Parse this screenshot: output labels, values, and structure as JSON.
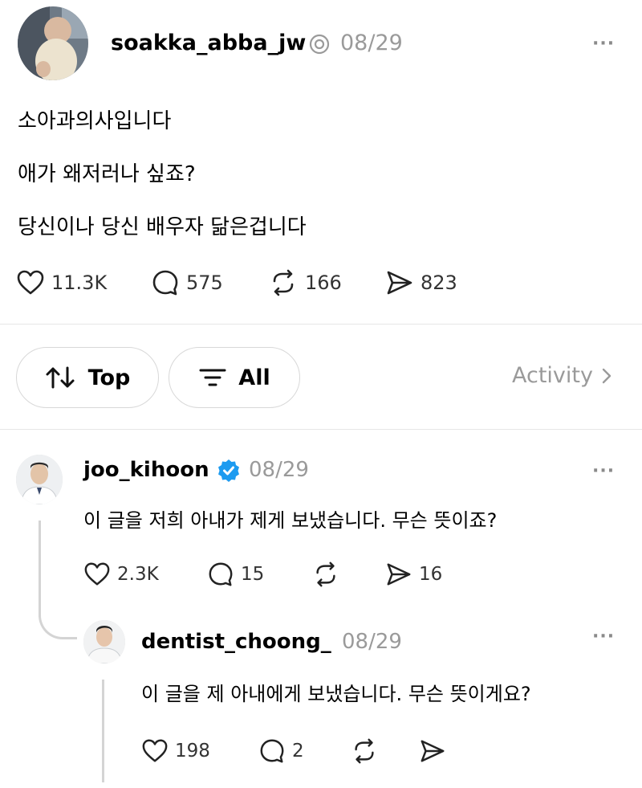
{
  "post": {
    "username": "soakka_abba_jw",
    "date": "08/29",
    "more": "···",
    "lines": [
      "소아과의사입니다",
      "애가 왜저러나 싶죠?",
      "당신이나 당신 배우자 닮은겁니다"
    ],
    "likes": "11.3K",
    "comments": "575",
    "reposts": "166",
    "shares": "823"
  },
  "filters": {
    "sort_label": "Top",
    "filter_label": "All",
    "activity_label": "Activity"
  },
  "reply1": {
    "username": "joo_kihoon",
    "date": "08/29",
    "more": "···",
    "text": "이 글을 저희 아내가 제게 보냈습니다. 무슨 뜻이죠?",
    "likes": "2.3K",
    "comments": "15",
    "shares": "16"
  },
  "reply2": {
    "username": "dentist_choong_",
    "date": "08/29",
    "more": "···",
    "text": "이 글을 제 아내에게 보냈습니다. 무슨 뜻이게요?",
    "likes": "198",
    "comments": "2"
  },
  "colors": {
    "verified": "#1d9bf0",
    "muted": "#9a9a9a",
    "divider": "#e6e6e6"
  }
}
